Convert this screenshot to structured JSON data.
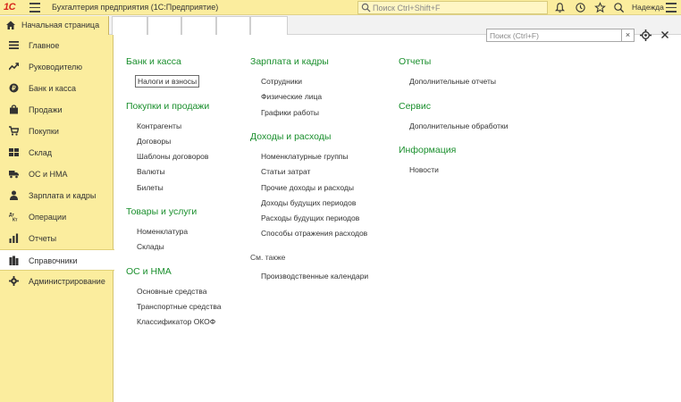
{
  "app": {
    "logo": "1С",
    "title": "Бухгалтерия предприятия  (1С:Предприятие)",
    "search_placeholder": "Поиск Ctrl+Shift+F",
    "user": "Надежда"
  },
  "tabs": {
    "home": "Начальная страница"
  },
  "sidebar": {
    "items": [
      {
        "label": "Главное",
        "icon": "menu-lines-icon"
      },
      {
        "label": "Руководителю",
        "icon": "trend-icon"
      },
      {
        "label": "Банк и касса",
        "icon": "coin-icon"
      },
      {
        "label": "Продажи",
        "icon": "bag-icon"
      },
      {
        "label": "Покупки",
        "icon": "cart-icon"
      },
      {
        "label": "Склад",
        "icon": "warehouse-icon"
      },
      {
        "label": "ОС и НМА",
        "icon": "truck-icon"
      },
      {
        "label": "Зарплата и кадры",
        "icon": "person-icon"
      },
      {
        "label": "Операции",
        "icon": "operations-icon"
      },
      {
        "label": "Отчеты",
        "icon": "bar-chart-icon"
      },
      {
        "label": "Справочники",
        "icon": "books-icon"
      },
      {
        "label": "Администрирование",
        "icon": "gear-icon"
      }
    ],
    "active_index": 10
  },
  "panel": {
    "search_placeholder": "Поиск (Ctrl+F)",
    "clear": "×",
    "col1": {
      "bank_heading": "Банк и касса",
      "bank_items": [
        "Налоги и взносы"
      ],
      "pp_heading": "Покупки и продажи",
      "pp_items": [
        "Контрагенты",
        "Договоры",
        "Шаблоны договоров",
        "Валюты",
        "Билеты"
      ],
      "goods_heading": "Товары и услуги",
      "goods_items": [
        "Номенклатура",
        "Склады"
      ],
      "os_heading": "ОС и НМА",
      "os_items": [
        "Основные средства",
        "Транспортные средства",
        "Классификатор ОКОФ"
      ]
    },
    "col2": {
      "zp_heading": "Зарплата и кадры",
      "zp_items": [
        "Сотрудники",
        "Физические лица",
        "Графики работы"
      ],
      "dr_heading": "Доходы и расходы",
      "dr_items": [
        "Номенклатурные группы",
        "Статьи затрат",
        "Прочие доходы и расходы",
        "Доходы будущих периодов",
        "Расходы будущих периодов",
        "Способы отражения расходов"
      ],
      "see_also": "См. также",
      "see_also_items": [
        "Производственные календари"
      ]
    },
    "col3": {
      "reports_heading": "Отчеты",
      "reports_items": [
        "Дополнительные отчеты"
      ],
      "service_heading": "Сервис",
      "service_items": [
        "Дополнительные обработки"
      ],
      "info_heading": "Информация",
      "info_items": [
        "Новости"
      ]
    }
  }
}
